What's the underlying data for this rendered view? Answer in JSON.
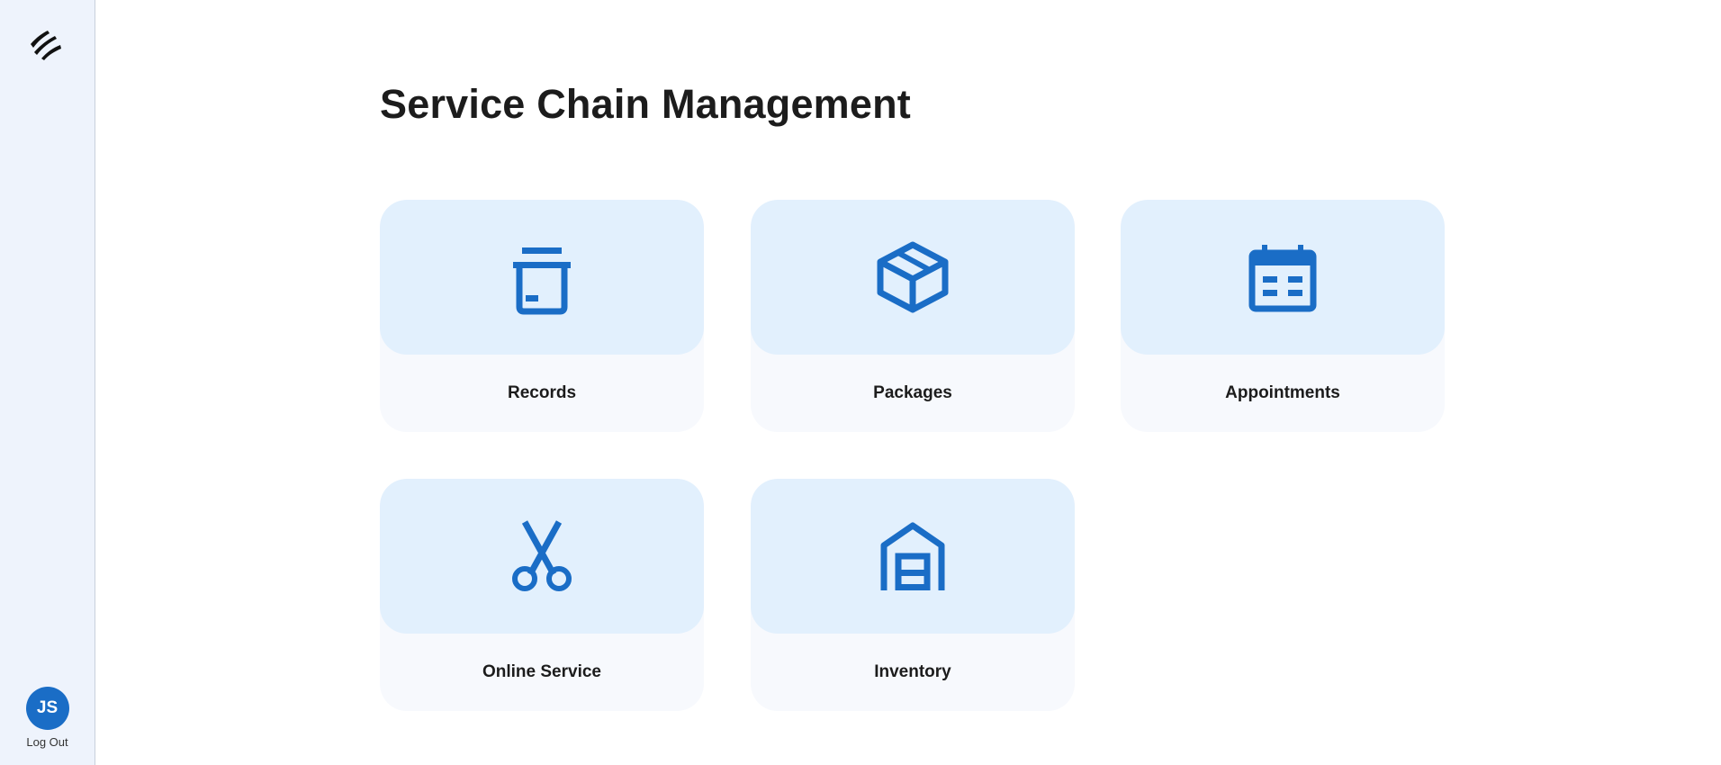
{
  "sidebar": {
    "logo_icon": "logo-icon",
    "user": {
      "initials": "JS",
      "logout_label": "Log Out"
    }
  },
  "main": {
    "title": "Service Chain Management",
    "cards": [
      {
        "label": "Records",
        "icon": "archive-box-icon"
      },
      {
        "label": "Packages",
        "icon": "package-icon"
      },
      {
        "label": "Appointments",
        "icon": "calendar-icon"
      },
      {
        "label": "Online Service",
        "icon": "scissors-icon"
      },
      {
        "label": "Inventory",
        "icon": "warehouse-icon"
      }
    ]
  },
  "colors": {
    "accent": "#1a6dc6",
    "card_top": "#e2f0fd",
    "card_bottom": "#f7f9fd",
    "sidebar_bg": "#eef3fc"
  }
}
